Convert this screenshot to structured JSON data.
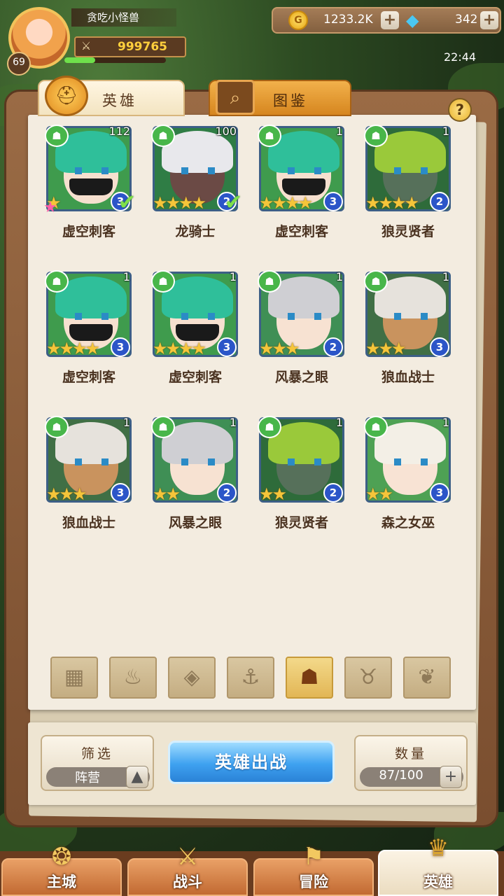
{
  "player": {
    "name": "贪吃小怪兽",
    "level": "69",
    "power": "999765",
    "xp_fraction": 0.3
  },
  "resources": {
    "gold": "1233.2K",
    "gems": "342"
  },
  "clock": "22:44",
  "tabs": [
    {
      "label": "英雄"
    },
    {
      "label": "图鉴"
    }
  ],
  "help_label": "?",
  "heroes": [
    {
      "name": "虚空刺客",
      "level": "112",
      "stars": 1,
      "tier": "3",
      "deployed": true,
      "rainbow": true,
      "theme": "green-elf"
    },
    {
      "name": "龙骑士",
      "level": "100",
      "stars": 4,
      "tier": "2",
      "deployed": true,
      "rainbow": false,
      "theme": "dark-elf"
    },
    {
      "name": "虚空刺客",
      "level": "1",
      "stars": 4,
      "tier": "3",
      "deployed": false,
      "rainbow": false,
      "theme": "green-elf"
    },
    {
      "name": "狼灵贤者",
      "level": "1",
      "stars": 4,
      "tier": "2",
      "deployed": false,
      "rainbow": false,
      "theme": "owl"
    },
    {
      "name": "虚空刺客",
      "level": "1",
      "stars": 4,
      "tier": "3",
      "deployed": false,
      "rainbow": false,
      "theme": "green-elf"
    },
    {
      "name": "虚空刺客",
      "level": "1",
      "stars": 4,
      "tier": "3",
      "deployed": false,
      "rainbow": false,
      "theme": "green-elf"
    },
    {
      "name": "风暴之眼",
      "level": "1",
      "stars": 3,
      "tier": "2",
      "deployed": false,
      "rainbow": false,
      "theme": "silver-boy"
    },
    {
      "name": "狼血战士",
      "level": "1",
      "stars": 3,
      "tier": "3",
      "deployed": false,
      "rainbow": false,
      "theme": "wolf"
    },
    {
      "name": "狼血战士",
      "level": "1",
      "stars": 3,
      "tier": "3",
      "deployed": false,
      "rainbow": false,
      "theme": "wolf"
    },
    {
      "name": "风暴之眼",
      "level": "1",
      "stars": 2,
      "tier": "2",
      "deployed": false,
      "rainbow": false,
      "theme": "silver-boy"
    },
    {
      "name": "狼灵贤者",
      "level": "1",
      "stars": 2,
      "tier": "2",
      "deployed": false,
      "rainbow": false,
      "theme": "owl"
    },
    {
      "name": "森之女巫",
      "level": "1",
      "stars": 2,
      "tier": "3",
      "deployed": false,
      "rainbow": false,
      "theme": "forest-witch"
    }
  ],
  "faction_filters": [
    {
      "name": "all",
      "icon": "▦",
      "active": false
    },
    {
      "name": "fire",
      "icon": "♨",
      "active": false
    },
    {
      "name": "diamond",
      "icon": "◈",
      "active": false
    },
    {
      "name": "anchor",
      "icon": "⚓",
      "active": false
    },
    {
      "name": "beast",
      "icon": "☗",
      "active": true
    },
    {
      "name": "horns",
      "icon": "♉",
      "active": false
    },
    {
      "name": "wings",
      "icon": "❦",
      "active": false
    }
  ],
  "filter_panel": {
    "title": "筛选",
    "value": "阵营",
    "button": "▲"
  },
  "deploy_label": "英雄出战",
  "count_panel": {
    "title": "数量",
    "value": "87/100",
    "button": "+"
  },
  "nav": [
    {
      "label": "主城",
      "icon": "❂",
      "active": false
    },
    {
      "label": "战斗",
      "icon": "⚔",
      "active": false
    },
    {
      "label": "冒险",
      "icon": "⚑",
      "active": false
    },
    {
      "label": "英雄",
      "icon": "♛",
      "active": true
    }
  ],
  "colors": {
    "star": "#f5c53a",
    "tier": "#2b55c8",
    "faction": "#48b64a",
    "deploy": "#3ea1f0"
  }
}
